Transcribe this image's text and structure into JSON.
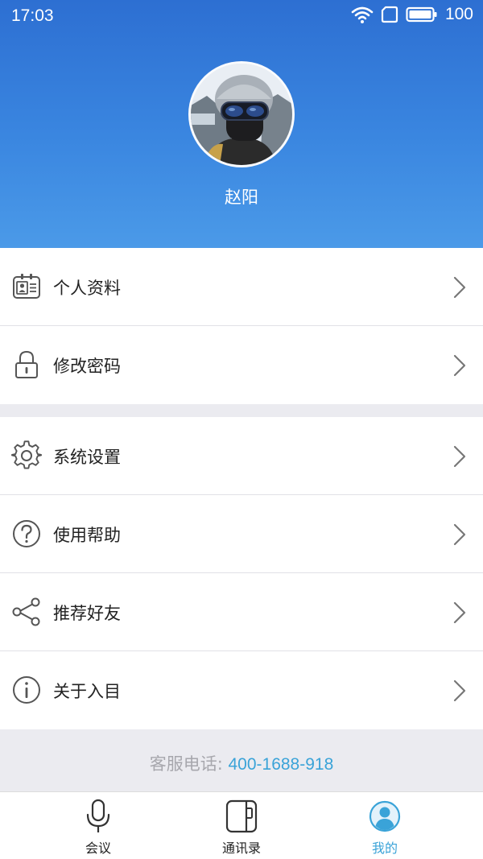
{
  "status_bar": {
    "time": "17:03",
    "battery": "100",
    "icons": [
      "wifi-icon",
      "sim-icon",
      "battery-icon"
    ]
  },
  "profile": {
    "name": "赵阳"
  },
  "menu": {
    "group1": [
      {
        "label": "个人资料",
        "icon": "id-card-icon"
      },
      {
        "label": "修改密码",
        "icon": "lock-icon"
      }
    ],
    "group2": [
      {
        "label": "系统设置",
        "icon": "gear-icon"
      },
      {
        "label": "使用帮助",
        "icon": "help-icon"
      },
      {
        "label": "推荐好友",
        "icon": "share-icon"
      },
      {
        "label": "关于入目",
        "icon": "info-icon"
      }
    ]
  },
  "hotline": {
    "label": "客服电话: ",
    "number": "400-1688-918"
  },
  "tabbar": {
    "items": [
      {
        "label": "会议",
        "icon": "microphone-icon",
        "active": false
      },
      {
        "label": "通讯录",
        "icon": "contacts-book-icon",
        "active": false
      },
      {
        "label": "我的",
        "icon": "user-icon",
        "active": true
      }
    ]
  },
  "colors": {
    "header_top": "#2d6fd2",
    "header_bottom": "#4b9ae8",
    "accent": "#3aa3d8",
    "page_background": "#ebebf0"
  }
}
